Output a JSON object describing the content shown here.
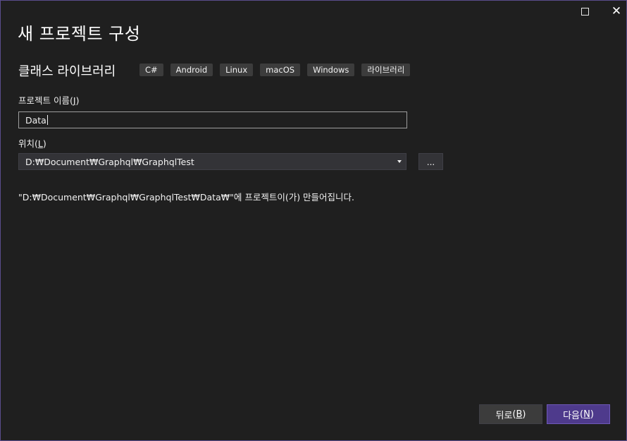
{
  "window": {
    "maximize_icon": "maximize-icon",
    "close_glyph": "✕"
  },
  "dialog": {
    "title": "새 프로젝트 구성"
  },
  "template": {
    "name": "클래스 라이브러리",
    "tags": [
      "C#",
      "Android",
      "Linux",
      "macOS",
      "Windows",
      "라이브러리"
    ]
  },
  "project_name": {
    "label": "프로젝트 이름",
    "hotkey_open": "(",
    "hotkey": "J",
    "hotkey_close": ")",
    "value": "Data"
  },
  "location": {
    "label": "위치",
    "hotkey_open": "(",
    "hotkey": "L",
    "hotkey_close": ")",
    "value": "D:₩Document₩Graphql₩GraphqlTest",
    "browse_label": "..."
  },
  "info": {
    "message": "\"D:₩Document₩Graphql₩GraphqlTest₩Data₩\"에 프로젝트이(가) 만들어집니다."
  },
  "footer": {
    "back_label": "뒤로",
    "back_hotkey": "B",
    "next_label": "다음",
    "next_hotkey": "N"
  },
  "colors": {
    "background": "#1f1f1f",
    "accent": "#4e3a8c",
    "border": "#5a4d8c"
  }
}
